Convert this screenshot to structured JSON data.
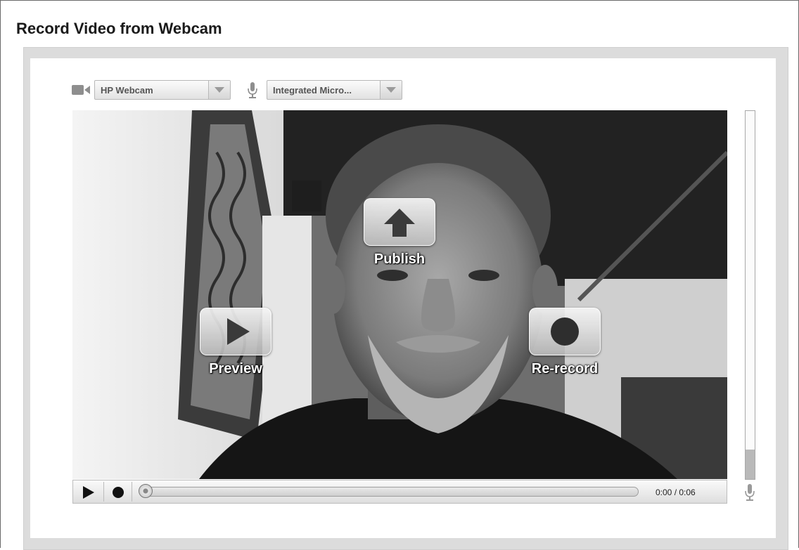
{
  "page": {
    "title": "Record Video from Webcam"
  },
  "devices": {
    "camera": {
      "icon": "video-camera-icon",
      "selected": "HP Webcam"
    },
    "microphone": {
      "icon": "microphone-icon",
      "selected": "Integrated Micro..."
    }
  },
  "overlay": {
    "publish": {
      "label": "Publish",
      "icon": "up-arrow-icon"
    },
    "preview": {
      "label": "Preview",
      "icon": "play-icon"
    },
    "rerecord": {
      "label": "Re-record",
      "icon": "record-icon"
    }
  },
  "controls": {
    "play_icon": "play-icon",
    "record_icon": "record-icon",
    "progress_fraction": 0.0,
    "time": "0:00 / 0:06"
  },
  "level_meter": {
    "level_fraction": 0.08,
    "icon": "microphone-icon"
  },
  "colors": {
    "frame": "#dcdcdc",
    "bar": "#e6e6e6",
    "label_text": "#ffffff"
  }
}
